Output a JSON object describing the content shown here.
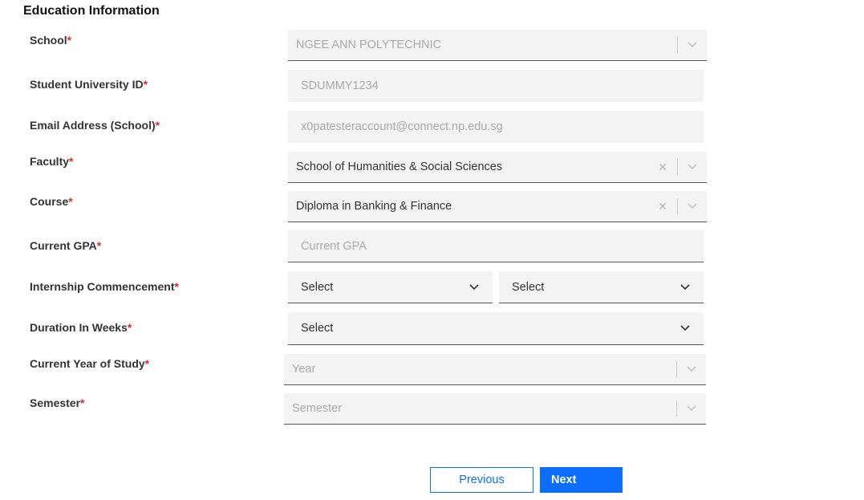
{
  "section": {
    "title": "Education Information"
  },
  "form": {
    "school": {
      "label": "School",
      "required": "*",
      "value": "NGEE ANN POLYTECHNIC"
    },
    "student_id": {
      "label": "Student University ID",
      "required": "*",
      "value": "SDUMMY1234"
    },
    "email": {
      "label": "Email Address (School)",
      "required": "*",
      "value": "x0patesteraccount@connect.np.edu.sg"
    },
    "faculty": {
      "label": "Faculty",
      "required": "*",
      "value": "School of Humanities & Social Sciences"
    },
    "course": {
      "label": "Course",
      "required": "*",
      "value": "Diploma in Banking & Finance"
    },
    "gpa": {
      "label": "Current GPA",
      "required": "*",
      "placeholder": "Current GPA"
    },
    "internship": {
      "label": "Internship Commencement",
      "required": "*",
      "month_value": "Select",
      "year_value": "Select"
    },
    "duration": {
      "label": "Duration In Weeks",
      "required": "*",
      "value": "Select"
    },
    "year_of_study": {
      "label": "Current Year of Study",
      "required": "*",
      "placeholder": "Year"
    },
    "semester": {
      "label": "Semester",
      "required": "*",
      "placeholder": "Semester"
    }
  },
  "buttons": {
    "previous": "Previous",
    "next": "Next"
  },
  "icons": {
    "clear": "clear-x-icon",
    "dropdown": "chevron-down-icon"
  },
  "colors": {
    "accent": "#0d6efd",
    "required": "#d32f2f",
    "field_bg": "#f3f3f4"
  }
}
